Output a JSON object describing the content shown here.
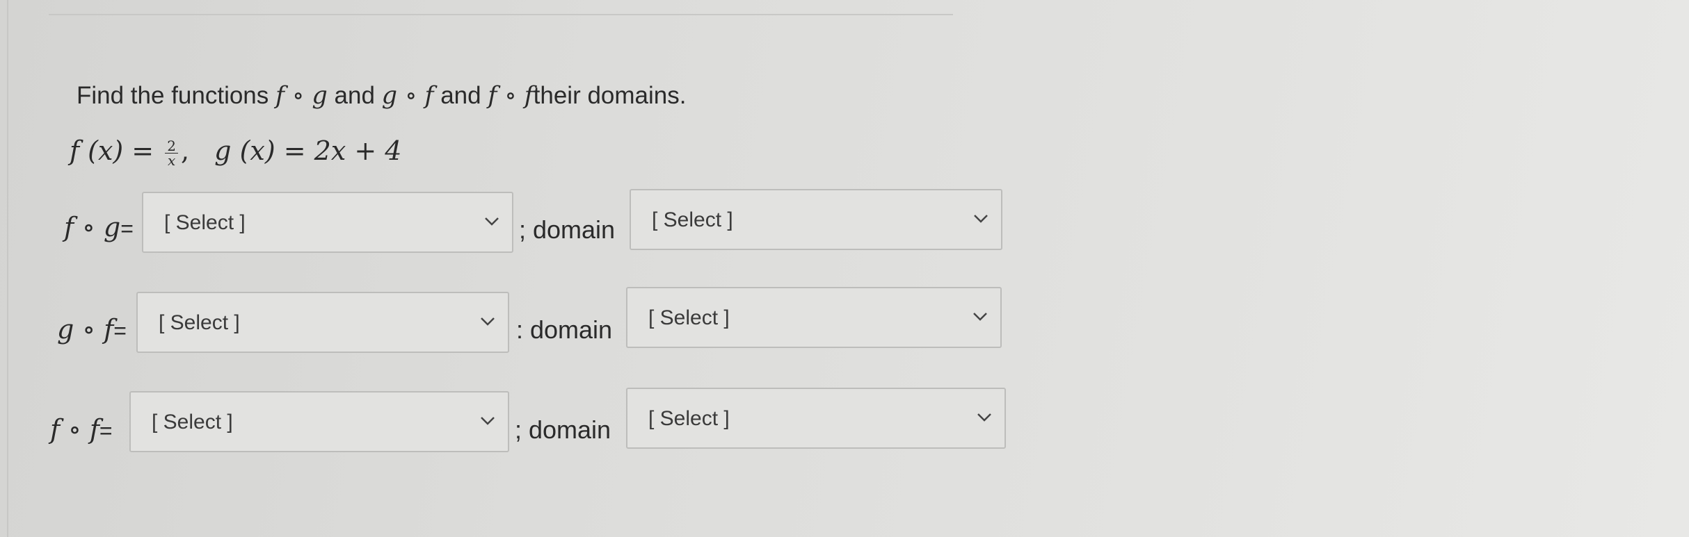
{
  "question": {
    "prefix": "Find the functions",
    "fg": "f ∘ g",
    "and1": "and",
    "gf": "g ∘ f",
    "and2": "and",
    "ff": "f ∘ f",
    "suffix": "their domains."
  },
  "formula": {
    "f_lhs": "f (x) =",
    "frac_num": "2",
    "frac_den": "x",
    "comma": ",",
    "g_def": "g (x) = 2x + 4"
  },
  "rows": [
    {
      "label": "f ∘ g",
      "eq": "=",
      "answer_value": "[ Select ]",
      "separator": "; domain",
      "domain_value": "[ Select ]"
    },
    {
      "label": "g ∘ f",
      "eq": "=",
      "answer_value": "[ Select ]",
      "separator": ": domain",
      "domain_value": "[ Select ]"
    },
    {
      "label": "f ∘ f",
      "eq": "=",
      "answer_value": "[ Select ]",
      "separator": "; domain",
      "domain_value": "[ Select ]"
    }
  ],
  "icons": {
    "dropdown": "chevron-down-icon"
  },
  "colors": {
    "background": "#dcdcda",
    "select_bg": "#e2e2e0",
    "select_border": "#bdbdbb",
    "text": "#2a2a2a"
  }
}
